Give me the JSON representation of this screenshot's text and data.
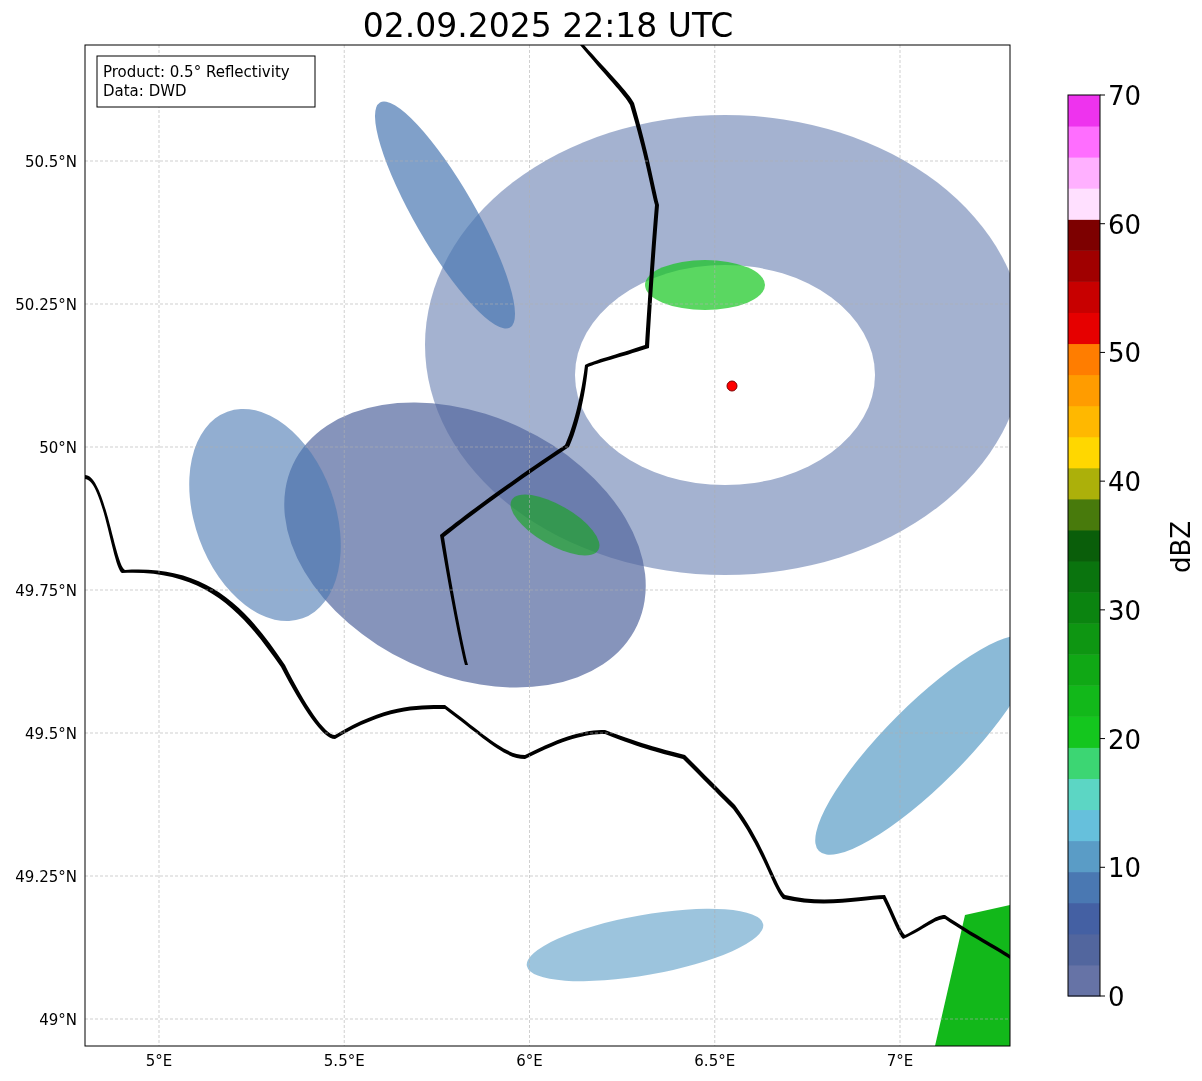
{
  "title": "02.09.2025 22:18 UTC",
  "legend": {
    "lines": [
      "Product: 0.5° Reflectivity",
      "Data: DWD"
    ]
  },
  "y_ticks": [
    "50.5°N",
    "50.25°N",
    "50°N",
    "49.75°N",
    "49.5°N",
    "49.25°N",
    "49°N"
  ],
  "x_ticks": [
    "5°E",
    "5.5°E",
    "6°E",
    "6.5°E",
    "7°E"
  ],
  "colorbar": {
    "label": "dBZ",
    "ticks": [
      "70",
      "60",
      "50",
      "40",
      "30",
      "20",
      "10",
      "0"
    ],
    "bands": [
      {
        "color": "#6673a6"
      },
      {
        "color": "#52669e"
      },
      {
        "color": "#4460a3"
      },
      {
        "color": "#4a78b2"
      },
      {
        "color": "#5a9cc6"
      },
      {
        "color": "#66c0dc"
      },
      {
        "color": "#5cd6c4"
      },
      {
        "color": "#3cd673"
      },
      {
        "color": "#14c61e"
      },
      {
        "color": "#12b81a"
      },
      {
        "color": "#10a815"
      },
      {
        "color": "#0e9612"
      },
      {
        "color": "#0b8410"
      },
      {
        "color": "#0a740e"
      },
      {
        "color": "#0a5e0a"
      },
      {
        "color": "#487a0c"
      },
      {
        "color": "#acb00a"
      },
      {
        "color": "#ffd700"
      },
      {
        "color": "#ffb800"
      },
      {
        "color": "#ff9c00"
      },
      {
        "color": "#ff7d00"
      },
      {
        "color": "#e60000"
      },
      {
        "color": "#c80000"
      },
      {
        "color": "#a00000"
      },
      {
        "color": "#7d0000"
      },
      {
        "color": "#ffe0ff"
      },
      {
        "color": "#ffb0ff"
      },
      {
        "color": "#ff6eff"
      },
      {
        "color": "#ee33ee"
      }
    ]
  }
}
